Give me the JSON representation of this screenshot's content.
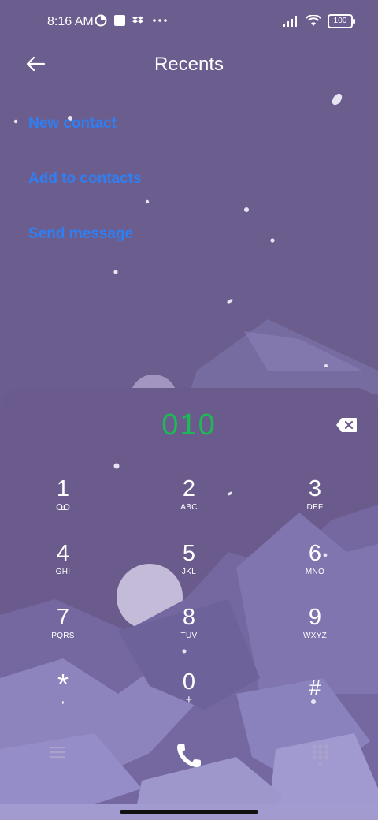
{
  "status_bar": {
    "time": "8:16 AM",
    "battery": "100",
    "left_icons": [
      "data-saver-icon",
      "square-notification-icon",
      "dropbox-icon",
      "more-dots-icon"
    ],
    "right_icons": [
      "signal-icon",
      "wifi-icon",
      "battery-icon"
    ]
  },
  "header": {
    "title": "Recents",
    "back_icon": "back-arrow-icon"
  },
  "actions": [
    "New contact",
    "Add to contacts",
    "Send message"
  ],
  "dialer": {
    "number": "010",
    "backspace_icon": "backspace-icon",
    "keys": [
      {
        "digit": "1",
        "letters": ""
      },
      {
        "digit": "2",
        "letters": "ABC"
      },
      {
        "digit": "3",
        "letters": "DEF"
      },
      {
        "digit": "4",
        "letters": "GHI"
      },
      {
        "digit": "5",
        "letters": "JKL"
      },
      {
        "digit": "6",
        "letters": "MNO"
      },
      {
        "digit": "7",
        "letters": "PQRS"
      },
      {
        "digit": "8",
        "letters": "TUV"
      },
      {
        "digit": "9",
        "letters": "WXYZ"
      },
      {
        "digit": "*",
        "letters": ","
      },
      {
        "digit": "0",
        "letters": "+"
      },
      {
        "digit": "#",
        "letters": ""
      }
    ]
  },
  "bottom_bar": {
    "menu_icon": "menu-icon",
    "call_icon": "phone-call-icon",
    "dialpad_icon": "dialpad-icon"
  },
  "colors": {
    "background": "#6b5e8e",
    "link": "#2f7ff3",
    "number": "#1db954"
  }
}
